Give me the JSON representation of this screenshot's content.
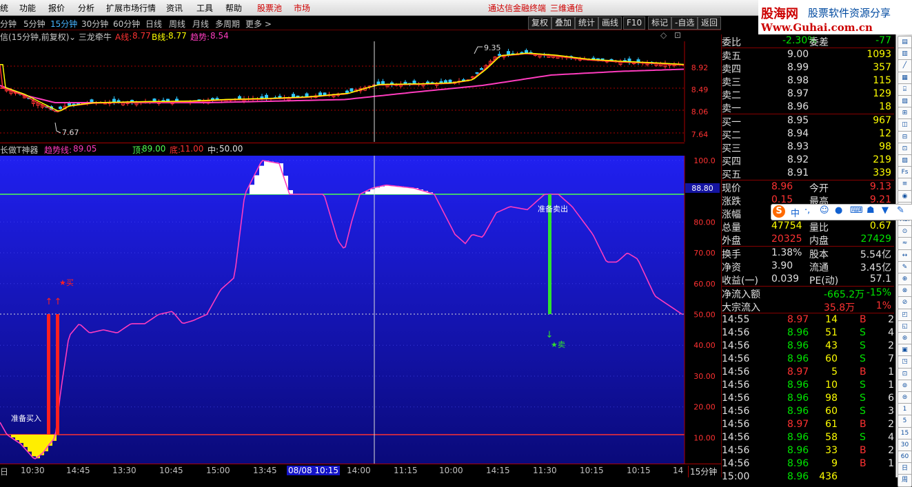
{
  "menu": {
    "items": [
      "统",
      "功能",
      "报价",
      "分析",
      "扩展市场行情",
      "资讯",
      "工具",
      "帮助"
    ],
    "red_items": [
      "股票池",
      "市场"
    ],
    "app_title": "通达信金融终端",
    "broker": "三维通信"
  },
  "logo": {
    "cn": "股海网",
    "url": "Www.Guhai.com.cn",
    "slogan": "股票软件资源分享"
  },
  "periods": [
    "分钟",
    "5分钟",
    "15分钟",
    "30分钟",
    "60分钟",
    "日线",
    "周线",
    "月线",
    "多周期",
    "更多"
  ],
  "active_period": "15分钟",
  "toolbar": [
    "复权",
    "叠加",
    "统计",
    "画线",
    "F10",
    "标记",
    "-自选",
    "返回"
  ],
  "main_info": {
    "prefix": "信(15分钟,前复权)",
    "indicator": "三龙牵牛",
    "a_label": "A线:",
    "a_val": "8.77",
    "b_label": "B线:",
    "b_val": "8.77",
    "trend_label": "趋势:",
    "trend_val": "8.54"
  },
  "main_yaxis": [
    "8.92",
    "8.49",
    "8.06",
    "7.64"
  ],
  "main_marks": {
    "high": "9.35",
    "low": "7.67"
  },
  "sub_info": {
    "name": "长做T神器",
    "trend_label": "趋势线:",
    "trend_val": "89.05",
    "top_label": "顶:",
    "top_val": "89.00",
    "bottom_label": "底:",
    "bottom_val": "11.00",
    "mid_label": "中:",
    "mid_val": "50.00"
  },
  "sub_yaxis": [
    "100.0",
    "80.00",
    "70.00",
    "60.00",
    "50.00",
    "40.00",
    "30.00",
    "20.00",
    "10.00"
  ],
  "sub_current": "88.80",
  "signals": {
    "prepare_buy": "准备买入",
    "buy": "买",
    "prepare_sell": "准备卖出",
    "sell": "卖"
  },
  "time_axis": [
    "日",
    "10:30",
    "14:45",
    "13:30",
    "10:45",
    "15:00",
    "13:45",
    "10:15",
    "14:00",
    "11:15",
    "10:00",
    "14:15",
    "11:30",
    "10:15",
    "14"
  ],
  "time_cursor": "08/08 10:15",
  "period_label": "15分钟",
  "quote": {
    "top": {
      "label": "委比",
      "val": "-2.30%",
      "label2": "委差",
      "val2": "-77"
    },
    "asks": [
      {
        "label": "卖五",
        "price": "9.00",
        "vol": "1093"
      },
      {
        "label": "卖四",
        "price": "8.99",
        "vol": "357"
      },
      {
        "label": "卖三",
        "price": "8.98",
        "vol": "115"
      },
      {
        "label": "卖二",
        "price": "8.97",
        "vol": "129"
      },
      {
        "label": "卖一",
        "price": "8.96",
        "vol": "18"
      }
    ],
    "bids": [
      {
        "label": "买一",
        "price": "8.95",
        "vol": "967"
      },
      {
        "label": "买二",
        "price": "8.94",
        "vol": "12"
      },
      {
        "label": "买三",
        "price": "8.93",
        "vol": "98"
      },
      {
        "label": "买四",
        "price": "8.92",
        "vol": "219"
      },
      {
        "label": "买五",
        "price": "8.91",
        "vol": "339"
      }
    ],
    "stats": [
      {
        "l1": "现价",
        "v1": "8.96",
        "l2": "今开",
        "v2": "9.13"
      },
      {
        "l1": "涨跌",
        "v1": "0.15",
        "l2": "最高",
        "v2": "9.21"
      },
      {
        "l1": "涨幅",
        "v1": "",
        "l2": "",
        "v2": ""
      },
      {
        "l1": "总量",
        "v1": "47754",
        "l2": "量比",
        "v2": "0.67"
      },
      {
        "l1": "外盘",
        "v1": "20325",
        "l2": "内盘",
        "v2": "27429"
      },
      {
        "l1": "换手",
        "v1": "1.38%",
        "l2": "股本",
        "v2": "5.54亿"
      },
      {
        "l1": "净资",
        "v1": "3.90",
        "l2": "流通",
        "v2": "3.45亿"
      },
      {
        "l1": "收益(一)",
        "v1": "0.039",
        "l2": "PE(动)",
        "v2": "57.1"
      }
    ],
    "flow": [
      {
        "label": "净流入额",
        "v1": "-665.2万",
        "v2": "-15%"
      },
      {
        "label": "大宗流入",
        "v1": "35.8万",
        "v2": "1%"
      }
    ],
    "ticks": [
      {
        "t": "14:55",
        "p": "8.97",
        "v": "14",
        "bs": "B",
        "n": "2"
      },
      {
        "t": "14:56",
        "p": "8.96",
        "v": "51",
        "bs": "S",
        "n": "4"
      },
      {
        "t": "14:56",
        "p": "8.96",
        "v": "43",
        "bs": "S",
        "n": "2"
      },
      {
        "t": "14:56",
        "p": "8.96",
        "v": "60",
        "bs": "S",
        "n": "7"
      },
      {
        "t": "14:56",
        "p": "8.97",
        "v": "5",
        "bs": "B",
        "n": "1"
      },
      {
        "t": "14:56",
        "p": "8.96",
        "v": "10",
        "bs": "S",
        "n": "1"
      },
      {
        "t": "14:56",
        "p": "8.96",
        "v": "98",
        "bs": "S",
        "n": "6"
      },
      {
        "t": "14:56",
        "p": "8.96",
        "v": "60",
        "bs": "S",
        "n": "3"
      },
      {
        "t": "14:56",
        "p": "8.97",
        "v": "61",
        "bs": "B",
        "n": "2"
      },
      {
        "t": "14:56",
        "p": "8.96",
        "v": "58",
        "bs": "S",
        "n": "4"
      },
      {
        "t": "14:56",
        "p": "8.96",
        "v": "33",
        "bs": "B",
        "n": "2"
      },
      {
        "t": "14:56",
        "p": "8.96",
        "v": "9",
        "bs": "B",
        "n": "1"
      },
      {
        "t": "15:00",
        "p": "8.96",
        "v": "436",
        "bs": "",
        "n": ""
      }
    ]
  },
  "right_tools": [
    "",
    "",
    "",
    "",
    "",
    "",
    "",
    "",
    "",
    "",
    "",
    "",
    "",
    "",
    "",
    "RSI",
    "",
    "",
    "",
    "",
    "",
    "",
    "",
    "",
    "",
    "",
    "",
    "",
    "",
    "",
    "",
    "1",
    "5",
    "15",
    "30",
    "60",
    "日",
    "周"
  ],
  "colors": {
    "up": "#ff3232",
    "down": "#00e600",
    "yellow": "#ffff00",
    "blue_bg": "#1c1ce8",
    "pink": "#ff3cbe",
    "green_line": "#50ff50"
  }
}
